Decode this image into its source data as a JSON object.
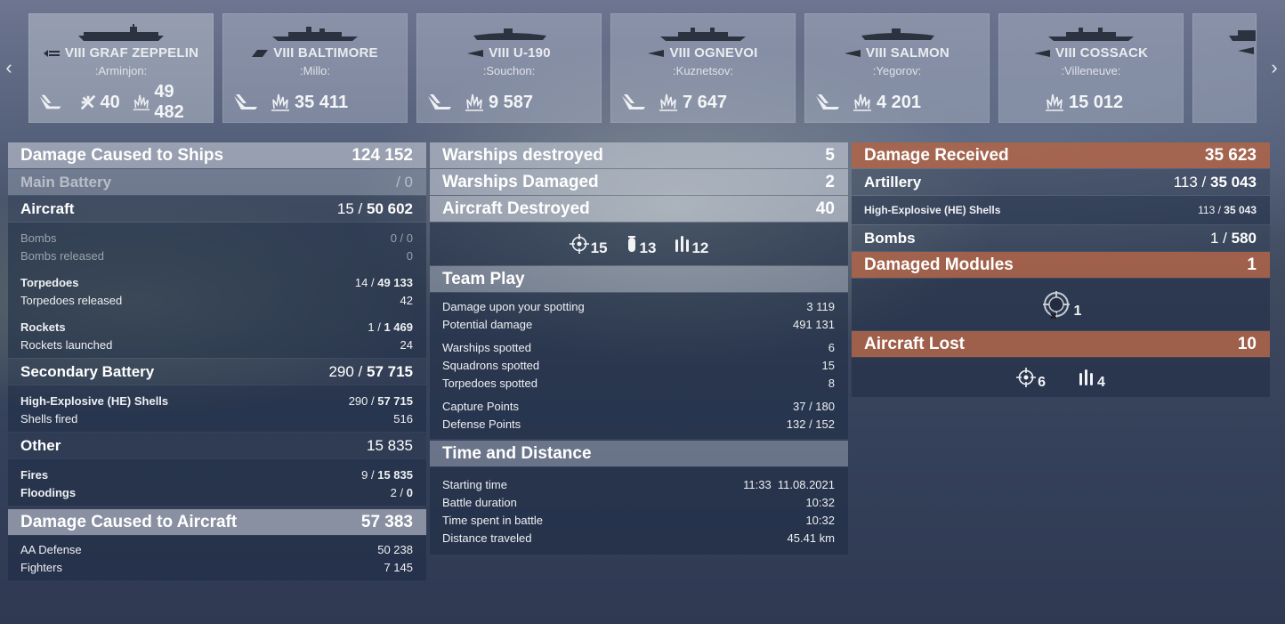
{
  "ships": [
    {
      "tier": "VIII",
      "name": "GRAF ZEPPELIN",
      "player": ":Arminjon:",
      "aircraft": "40",
      "damage": "49 482"
    },
    {
      "tier": "VIII",
      "name": "BALTIMORE",
      "player": ":Millo:",
      "damage": "35 411"
    },
    {
      "tier": "VIII",
      "name": "U-190",
      "player": ":Souchon:",
      "damage": "9 587"
    },
    {
      "tier": "VIII",
      "name": "OGNEVOI",
      "player": ":Kuznetsov:",
      "damage": "7 647"
    },
    {
      "tier": "VIII",
      "name": "SALMON",
      "player": ":Yegorov:",
      "damage": "4 201"
    },
    {
      "tier": "VIII",
      "name": "COSSACK",
      "player": ":Villeneuve:",
      "damage": "15 012"
    }
  ],
  "damage_ships": {
    "title": "Damage Caused to Ships",
    "value": "124 152",
    "main_battery": {
      "label": "Main Battery",
      "value": "/ 0"
    },
    "aircraft": {
      "label": "Aircraft",
      "hits": "15 /",
      "value": "50 602"
    },
    "bombs": {
      "label": "Bombs",
      "value": "0 / 0"
    },
    "bombs_released": {
      "label": "Bombs released",
      "value": "0"
    },
    "torpedoes": {
      "label": "Torpedoes",
      "hits": "14 /",
      "value": "49 133"
    },
    "torpedoes_released": {
      "label": "Torpedoes released",
      "value": "42"
    },
    "rockets": {
      "label": "Rockets",
      "hits": "1 /",
      "value": "1 469"
    },
    "rockets_launched": {
      "label": "Rockets launched",
      "value": "24"
    },
    "secondary": {
      "label": "Secondary Battery",
      "hits": "290 /",
      "value": "57 715"
    },
    "he_shells": {
      "label": "High-Explosive (HE) Shells",
      "hits": "290 /",
      "value": "57 715"
    },
    "shells_fired": {
      "label": "Shells fired",
      "value": "516"
    },
    "other": {
      "label": "Other",
      "value": "15 835"
    },
    "fires": {
      "label": "Fires",
      "hits": "9 /",
      "value": "15 835"
    },
    "floodings": {
      "label": "Floodings",
      "hits": "2 /",
      "value": "0"
    }
  },
  "damage_aircraft": {
    "title": "Damage Caused to Aircraft",
    "value": "57 383",
    "aa_defense": {
      "label": "AA Defense",
      "value": "50 238"
    },
    "fighters": {
      "label": "Fighters",
      "value": "7 145"
    }
  },
  "kills": {
    "warships_destroyed": {
      "label": "Warships destroyed",
      "value": "5"
    },
    "warships_damaged": {
      "label": "Warships Damaged",
      "value": "2"
    },
    "aircraft_destroyed": {
      "label": "Aircraft Destroyed",
      "value": "40"
    },
    "aircraft_breakdown": {
      "fighter": "15",
      "bomber": "13",
      "torpedo": "12"
    }
  },
  "team_play": {
    "title": "Team Play",
    "rows": [
      {
        "label": "Damage upon your spotting",
        "value": "3 119"
      },
      {
        "label": "Potential damage",
        "value": "491 131"
      },
      {
        "label": "Warships spotted",
        "value": "6"
      },
      {
        "label": "Squadrons spotted",
        "value": "15"
      },
      {
        "label": "Torpedoes spotted",
        "value": "8"
      },
      {
        "label": "Capture Points",
        "value": "37 / 180"
      },
      {
        "label": "Defense Points",
        "value": "132 / 152"
      }
    ]
  },
  "time_distance": {
    "title": "Time and Distance",
    "rows": [
      {
        "label": "Starting time",
        "value": "11:33  11.08.2021"
      },
      {
        "label": "Battle duration",
        "value": "10:32"
      },
      {
        "label": "Time spent in battle",
        "value": "10:32"
      },
      {
        "label": "Distance traveled",
        "value": "45.41 km"
      }
    ]
  },
  "received": {
    "title": "Damage Received",
    "value": "35 623",
    "artillery": {
      "label": "Artillery",
      "hits": "113 /",
      "value": "35 043"
    },
    "he_shells": {
      "label": "High-Explosive (HE) Shells",
      "hits": "113 /",
      "value": "35 043"
    },
    "bombs": {
      "label": "Bombs",
      "hits": "1 /",
      "value": "580"
    }
  },
  "modules": {
    "title": "Damaged Modules",
    "value": "1",
    "count": "1"
  },
  "aircraft_lost": {
    "title": "Aircraft Lost",
    "value": "10",
    "fighter": "6",
    "torpedo": "4"
  },
  "colors": {
    "received_header": "#b06448",
    "panel": "#1e2c44"
  }
}
